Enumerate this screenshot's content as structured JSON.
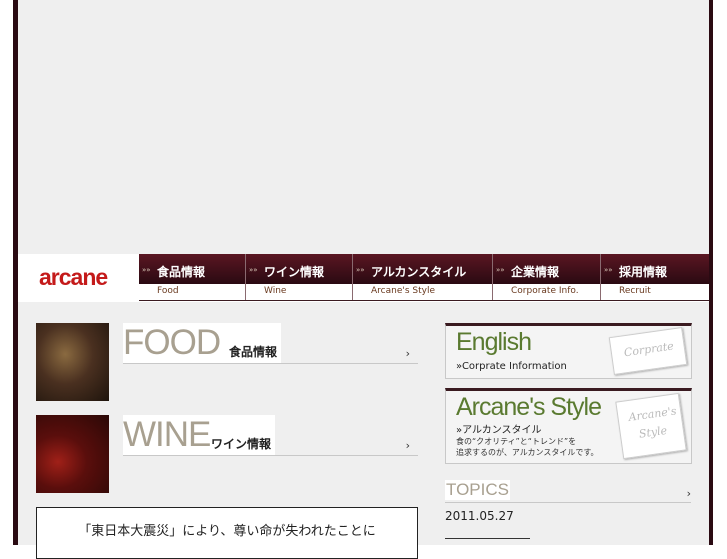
{
  "nav": {
    "logo": "arcane",
    "items": [
      {
        "jp": "食品情報",
        "en": "Food"
      },
      {
        "jp": "ワイン情報",
        "en": "Wine"
      },
      {
        "jp": "アルカンスタイル",
        "en": "Arcane's Style"
      },
      {
        "jp": "企業情報",
        "en": "Corporate Info."
      },
      {
        "jp": "採用情報",
        "en": "Recruit"
      }
    ],
    "arrow": "»»"
  },
  "sections": {
    "food": {
      "big": "FOOD",
      "jp": "食品情報",
      "go": "›"
    },
    "wine": {
      "big": "WINE",
      "jp": "ワイン情報",
      "go": "›"
    }
  },
  "notice": {
    "text": "「東日本大震災」により、尊い命が失われたことに"
  },
  "banners": {
    "english": {
      "title": "English",
      "sub": "»Corprate Information",
      "card": "Corprate"
    },
    "style": {
      "title": "Arcane's Style",
      "sub": "»アルカンスタイル",
      "desc1": "食の“クオリティ”と“トレンド”を",
      "desc2": "追求するのが、アルカンスタイルです。",
      "card1": "Arcane's",
      "card2": "Style"
    }
  },
  "topics": {
    "title": "TOPICS",
    "go": "›",
    "date": "2011.05.27"
  },
  "colors": {
    "brand_red": "#c41a1a",
    "nav_dark": "#2a0a12",
    "heading_gray": "#a8a090",
    "banner_green": "#5a7a30"
  }
}
